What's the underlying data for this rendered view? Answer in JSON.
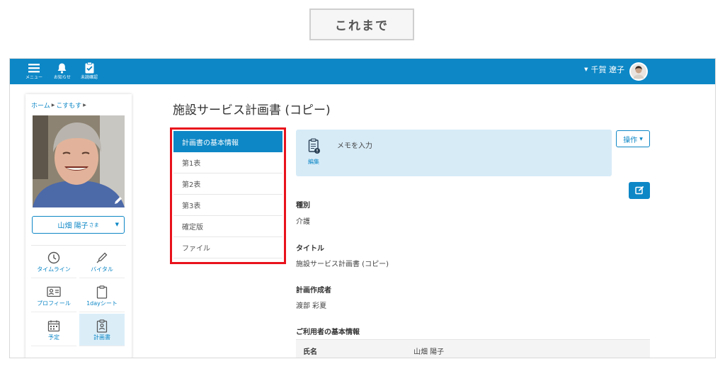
{
  "caption": "これまで",
  "topbar": {
    "menu_label": "メニュー",
    "notice_label": "お知らせ",
    "unchecked_label": "未読確認",
    "user_name": "千賀 遼子"
  },
  "sidebar": {
    "breadcrumb": [
      "ホーム",
      "こすもす"
    ],
    "resident_name": "山畑 陽子",
    "honorific": "さま",
    "nav": [
      {
        "label": "タイムライン",
        "icon": "clock-icon"
      },
      {
        "label": "バイタル",
        "icon": "thermometer-icon"
      },
      {
        "label": "プロフィール",
        "icon": "id-card-icon"
      },
      {
        "label": "1dayシート",
        "icon": "clipboard-icon"
      },
      {
        "label": "予定",
        "icon": "calendar-icon"
      },
      {
        "label": "計画書",
        "icon": "plan-doc-icon",
        "active": true
      }
    ]
  },
  "main": {
    "title": "施設サービス計画書 (コピー)",
    "submenu": [
      "計画書の基本情報",
      "第1表",
      "第2表",
      "第3表",
      "確定版",
      "ファイル"
    ],
    "memo_placeholder": "メモを入力",
    "memo_edit_label": "編集",
    "ops_label": "操作",
    "fields": [
      {
        "label": "種別",
        "value": "介護"
      },
      {
        "label": "タイトル",
        "value": "施設サービス計画書 (コピー)"
      },
      {
        "label": "計画作成者",
        "value": "渡部 彩夏"
      }
    ],
    "user_info_heading": "ご利用者の基本情報",
    "user_info_rows": [
      {
        "key": "氏名",
        "value": "山畑 陽子"
      }
    ]
  },
  "colors": {
    "accent": "#0d87c6",
    "highlight_border": "#e8121c",
    "memo_bg": "#d7ebf7"
  }
}
